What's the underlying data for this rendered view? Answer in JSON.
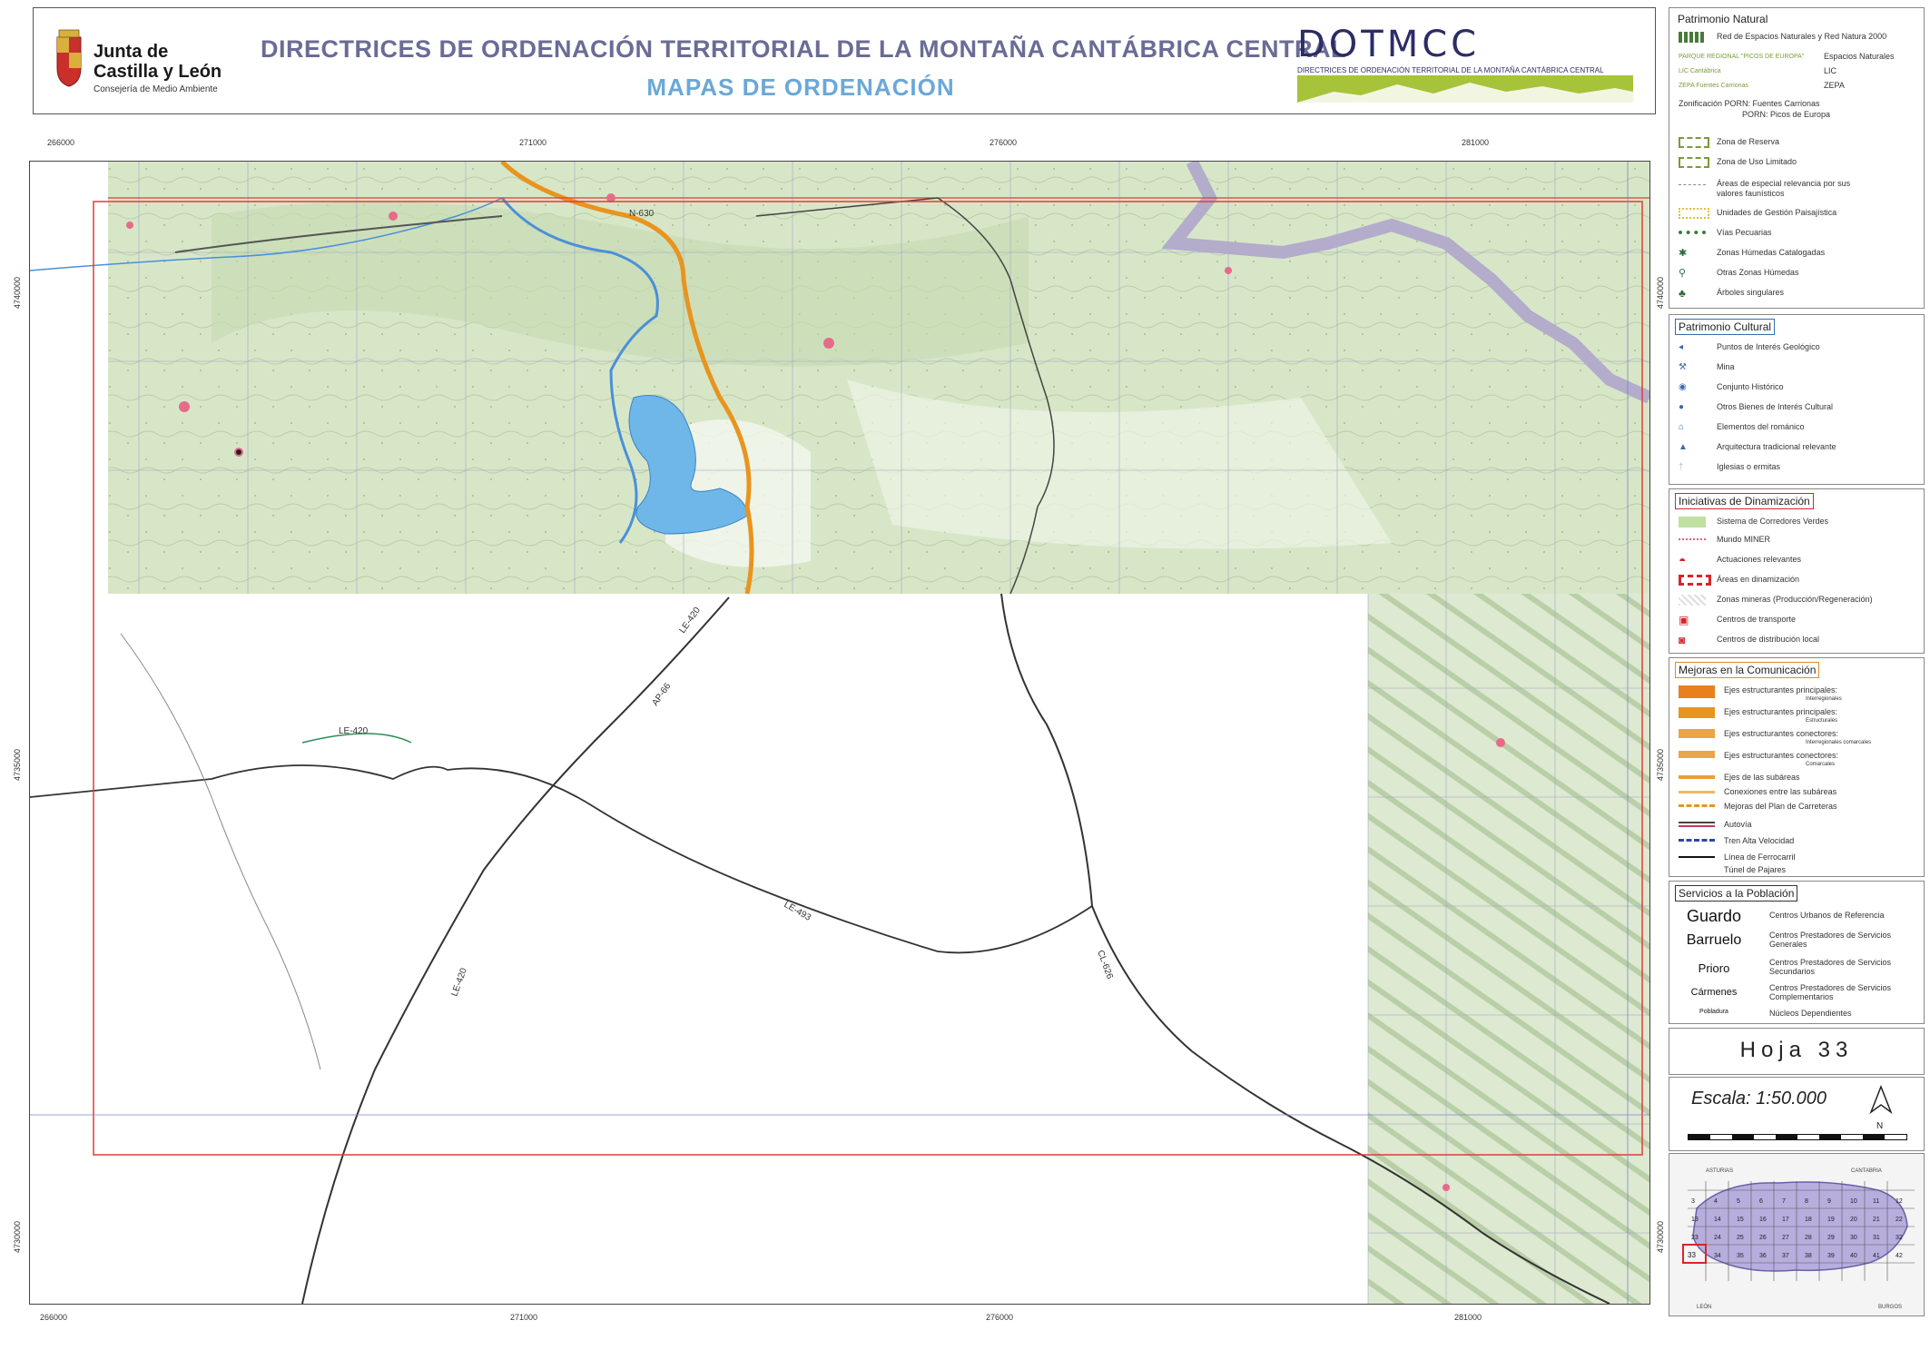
{
  "header": {
    "logo_line1": "Junta de",
    "logo_line2": "Castilla y León",
    "logo_sub": "Consejería de Medio Ambiente",
    "title_main": "DIRECTRICES DE ORDENACIÓN TERRITORIAL DE LA MONTAÑA CANTÁBRICA CENTRAL",
    "title_sub": "MAPAS DE ORDENACIÓN",
    "dotmcc": "DOTMCC",
    "dotmcc_sub": "DIRECTRICES DE ORDENACIÓN TERRITORIAL DE LA MONTAÑA CANTÁBRICA CENTRAL"
  },
  "map": {
    "coords_top": [
      "266000",
      "271000",
      "276000",
      "281000"
    ],
    "coords_bottom": [
      "266000",
      "271000",
      "276000",
      "281000"
    ],
    "coords_left": [
      "4740000",
      "4735000",
      "4730000"
    ],
    "coords_right": [
      "4740000",
      "4735000",
      "4730000"
    ],
    "road_labels": [
      "LE-420",
      "N-630",
      "LE-420",
      "LE-493",
      "CL-626",
      "LE-420",
      "AP-66"
    ],
    "colors": {
      "topo_green": "#cfe0bf",
      "river": "#4a90d9",
      "reservoir": "#6fb7e8",
      "road_orange": "#e8941f",
      "red_frame": "#e23b3b",
      "purple_border": "#b7b0cf"
    }
  },
  "legend": {
    "natural": {
      "title": "Patrimonio Natural",
      "items": [
        {
          "label": "Red de Espacios Naturales y Red Natura 2000",
          "icon": "network-icon"
        },
        {
          "label": "PARQUE REGIONAL \"PICOS DE EUROPA\"",
          "label2": "Espacios Naturales"
        },
        {
          "label": "LIC Cantábrica",
          "label2": "LIC"
        },
        {
          "label": "ZEPA Fuentes Carrionas",
          "label2": "ZEPA"
        },
        {
          "label": "Zonificación   PORN: Fuentes Carrionas"
        },
        {
          "label": "PORN: Picos de Europa"
        },
        {
          "label": "Zona de Reserva"
        },
        {
          "label": "Zona de Uso Limitado"
        },
        {
          "label": "Áreas de especial relevancia por sus valores faunísticos"
        },
        {
          "label": "Unidades de Gestión Paisajística"
        },
        {
          "label": "Vías Pecuarias"
        },
        {
          "label": "Zonas Húmedas Catalogadas"
        },
        {
          "label": "Otras Zonas Húmedas"
        },
        {
          "label": "Árboles singulares"
        }
      ]
    },
    "cultural": {
      "title": "Patrimonio Cultural",
      "items": [
        {
          "label": "Puntos de Interés Geológico"
        },
        {
          "label": "Mina"
        },
        {
          "label": "Conjunto Histórico"
        },
        {
          "label": "Otros Bienes de Interés Cultural"
        },
        {
          "label": "Elementos del románico"
        },
        {
          "label": "Arquitectura tradicional relevante"
        },
        {
          "label": "Iglesias o ermitas"
        }
      ]
    },
    "dinamizacion": {
      "title": "Iniciativas de Dinamización",
      "items": [
        {
          "label": "Sistema de Corredores Verdes"
        },
        {
          "label": "Mundo MINER"
        },
        {
          "label": "Actuaciones relevantes"
        },
        {
          "label": "Áreas en dinamización"
        },
        {
          "label": "Zonas mineras (Producción/Regeneración)"
        },
        {
          "label": "Centros de transporte"
        },
        {
          "label": "Centros de distribución local"
        }
      ]
    },
    "comunicacion": {
      "title": "Mejoras en la Comunicación",
      "items": [
        {
          "label": "Ejes estructurantes principales:",
          "sub": "Interregionales"
        },
        {
          "label": "Ejes estructurantes principales:",
          "sub": "Estructurales"
        },
        {
          "label": "Ejes estructurantes conectores:",
          "sub": "Interregionales comarcales"
        },
        {
          "label": "Ejes estructurantes conectores:",
          "sub": "Comarcales"
        },
        {
          "label": "Ejes de las subáreas"
        },
        {
          "label": "Conexiones entre las subáreas"
        },
        {
          "label": "Mejoras del Plan de Carreteras"
        },
        {
          "label": "Autovía"
        },
        {
          "label": "Tren Alta Velocidad"
        },
        {
          "label": "Línea de Ferrocarril"
        },
        {
          "label": "Túnel de Pajares"
        }
      ]
    },
    "servicios": {
      "title": "Servicios a la Población",
      "items": [
        {
          "name": "Guardo",
          "desc": "Centros Urbanos de Referencia"
        },
        {
          "name": "Barruelo",
          "desc": "Centros Prestadores de Servicios Generales"
        },
        {
          "name": "Prioro",
          "desc": "Centros Prestadores de Servicios Secundarios"
        },
        {
          "name": "Cármenes",
          "desc": "Centros Prestadores de Servicios Complementarios"
        },
        {
          "name": "Pobladura",
          "desc": "Núcleos Dependientes"
        }
      ]
    },
    "hoja": "Hoja  33",
    "escala": "Escala: 1:50.000",
    "north": "N",
    "inset_labels": [
      "ASTURIAS",
      "CANTABRIA",
      "LEÓN",
      "BURGOS"
    ],
    "inset_sheets": [
      "3",
      "4",
      "5",
      "6",
      "7",
      "8",
      "9",
      "10",
      "11",
      "12",
      "13",
      "14",
      "15",
      "16",
      "17",
      "18",
      "19",
      "20",
      "21",
      "22",
      "23",
      "24",
      "25",
      "26",
      "27",
      "28",
      "29",
      "30",
      "31",
      "32",
      "33",
      "34",
      "35",
      "36",
      "37",
      "38",
      "39",
      "40",
      "41",
      "42"
    ],
    "current_sheet": "33"
  }
}
